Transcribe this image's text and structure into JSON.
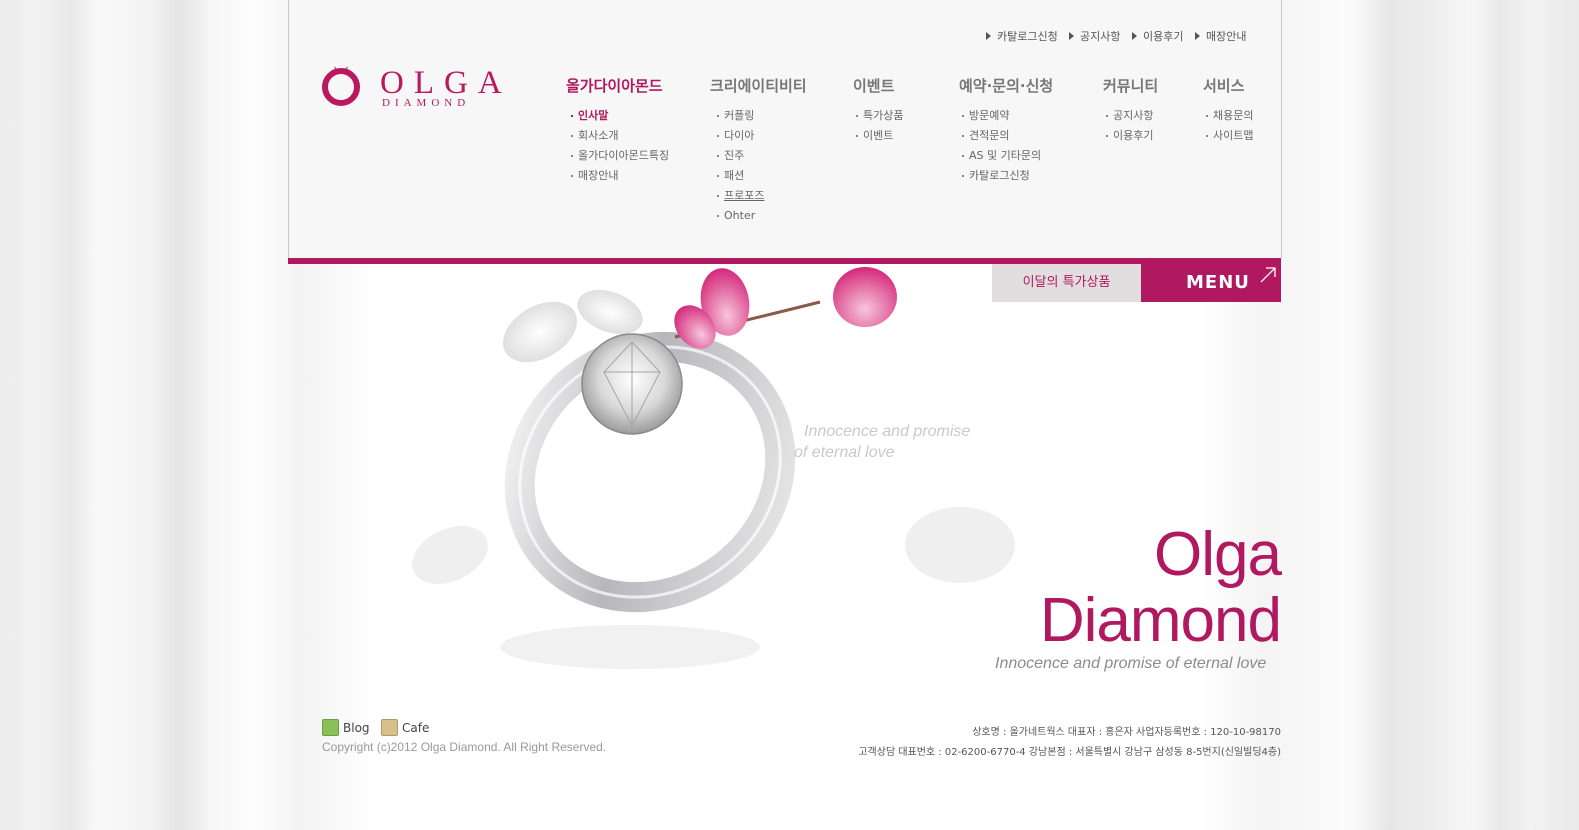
{
  "util_links": [
    "카탈로그신청",
    "공지사항",
    "이용후기",
    "매장안내"
  ],
  "logo": {
    "word": "OLGA",
    "sub": "DIAMOND"
  },
  "menus": [
    {
      "title": "올가다이아몬드",
      "items": [
        "인사말",
        "회사소개",
        "올가다이아몬드특징",
        "매장안내"
      ]
    },
    {
      "title": "크리에이티비티",
      "items": [
        "커플링",
        "다이아",
        "진주",
        "패션",
        "프로포즈",
        "Ohter"
      ]
    },
    {
      "title": "이벤트",
      "items": [
        "특가상품",
        "이벤트"
      ]
    },
    {
      "title": "예약·문의·신청",
      "items": [
        "방문예약",
        "견적문의",
        "AS 및 기타문의",
        "카탈로그신청"
      ]
    },
    {
      "title": "커뮤니티",
      "items": [
        "공지사항",
        "이용후기"
      ]
    },
    {
      "title": "서비스",
      "items": [
        "채용문의",
        "사이트맵"
      ]
    }
  ],
  "special_tab": "이달의 특가상품",
  "menu_tab": "MENU",
  "hero": {
    "tagline_line1": "Innocence and promise",
    "tagline_line2": "of eternal love",
    "brand_line1": "Olga",
    "brand_line2": "Diamond",
    "brand_tagline": "Innocence and promise of eternal love"
  },
  "footer": {
    "blog": "Blog",
    "cafe": "Cafe",
    "copyright": "Copyright (c)2012 Olga Diamond. All Right Reserved.",
    "company_line1": "상호명 : 올가네트웍스    대표자 : 홍은자    사업자등록번호 : 120-10-98170",
    "company_line2": "고객상담 대표번호 : 02-6200-6770-4    강남본점 : 서울특별시 강남구 삼성동 8-5번지(신일빌딩4층)"
  },
  "colors": {
    "accent": "#b0185f",
    "tab_bg": "#e2dedf"
  }
}
